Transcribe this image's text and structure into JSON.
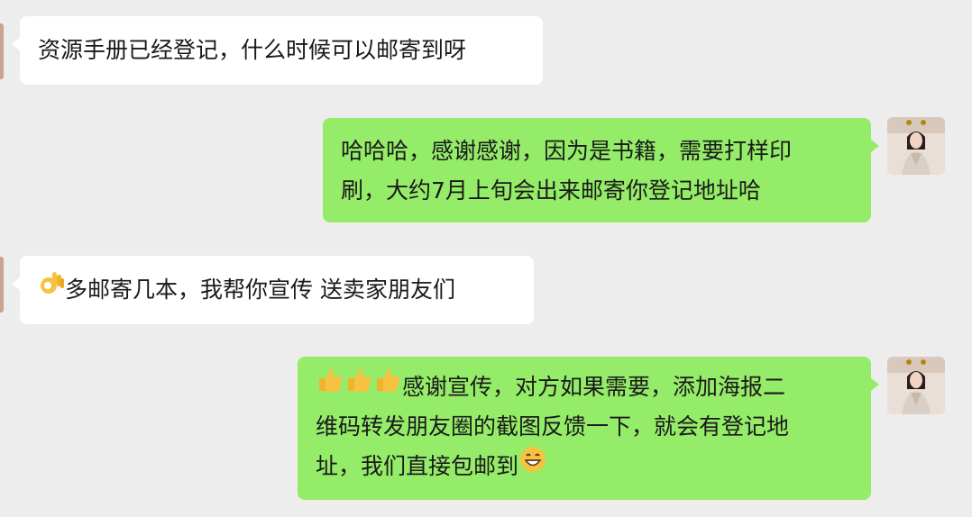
{
  "messages": [
    {
      "side": "in",
      "lines": [
        "资源手册已经登记，什么时候可以邮寄到呀"
      ]
    },
    {
      "side": "out",
      "lines": [
        "哈哈哈，感谢感谢，因为是书籍，需要打样印",
        "刷，大约7月上旬会出来邮寄你登记地址哈"
      ]
    },
    {
      "side": "in",
      "emoji_lead": "ok-hand-emoji",
      "lines": [
        "多邮寄几本，我帮你宣传 送卖家朋友们"
      ]
    },
    {
      "side": "out",
      "emoji_lead": "thumbs-up-emoji x3",
      "emoji_tail": "grinning-face-emoji",
      "lines": [
        "感谢宣传，对方如果需要，添加海报二",
        "维码转发朋友圈的截图反馈一下，就会有登记地",
        "址，我们直接包邮到"
      ]
    }
  ]
}
